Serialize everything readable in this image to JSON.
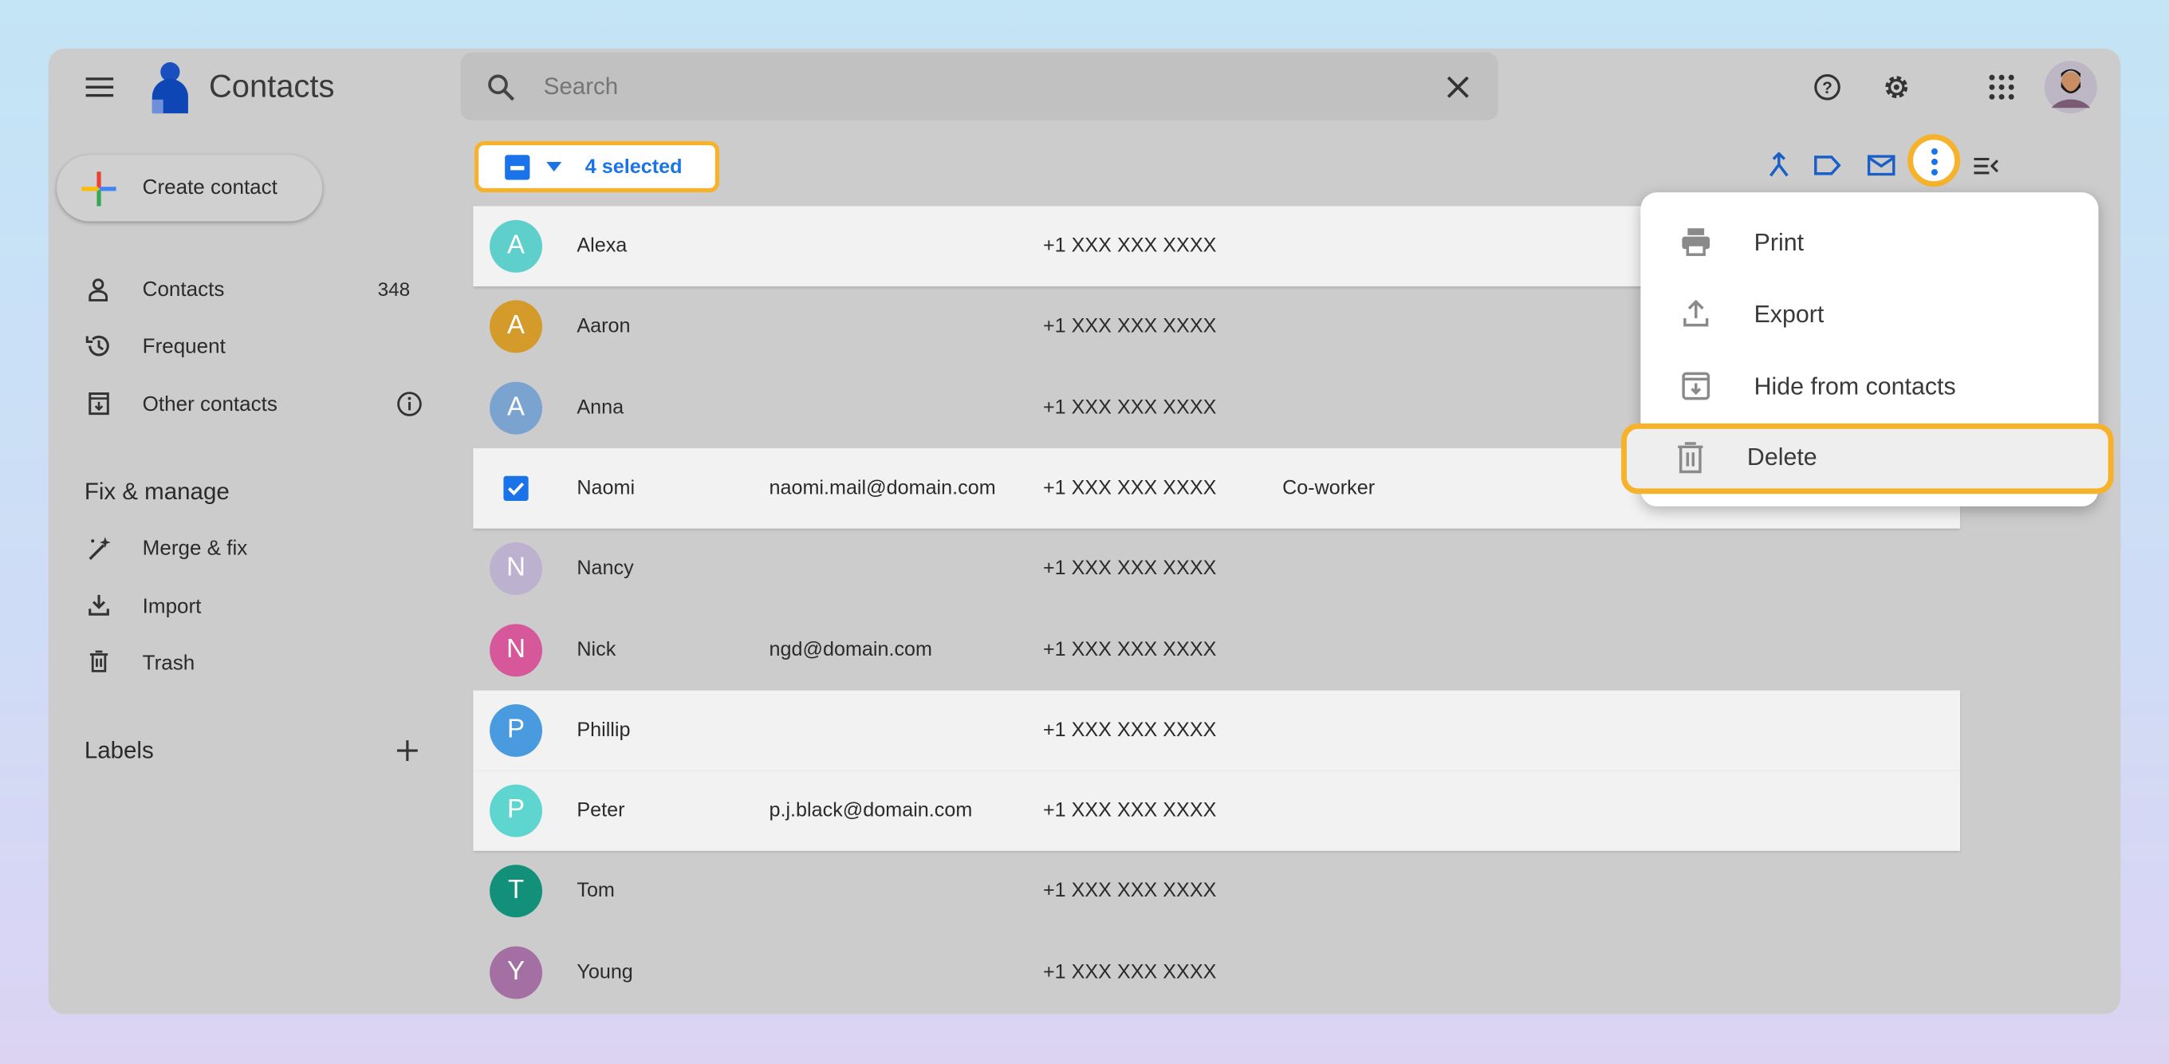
{
  "app": {
    "title": "Contacts"
  },
  "search": {
    "placeholder": "Search"
  },
  "selection": {
    "label": "4 selected"
  },
  "sidebar": {
    "create_label": "Create contact",
    "items": [
      {
        "label": "Contacts",
        "count": "348"
      },
      {
        "label": "Frequent"
      },
      {
        "label": "Other contacts"
      }
    ],
    "fix_heading": "Fix & manage",
    "fix_items": [
      {
        "label": "Merge & fix"
      },
      {
        "label": "Import"
      },
      {
        "label": "Trash"
      }
    ],
    "labels_heading": "Labels"
  },
  "contacts": [
    {
      "initial": "A",
      "name": "Alexa",
      "email": "",
      "phone": "+1 XXX XXX XXXX",
      "label": "",
      "color": "#5ecfca",
      "selected": true
    },
    {
      "initial": "A",
      "name": "Aaron",
      "email": "",
      "phone": "+1 XXX XXX XXXX",
      "label": "",
      "color": "#d49b2a",
      "selected": false
    },
    {
      "initial": "A",
      "name": "Anna",
      "email": "",
      "phone": "+1 XXX XXX XXXX",
      "label": "",
      "color": "#7ba3d0",
      "selected": false
    },
    {
      "initial": "",
      "name": "Naomi",
      "email": "naomi.mail@domain.com",
      "phone": "+1 XXX XXX XXXX",
      "label": "Co-worker",
      "color": "#1a73e8",
      "selected": true,
      "checked": true
    },
    {
      "initial": "N",
      "name": "Nancy",
      "email": "",
      "phone": "+1 XXX XXX XXXX",
      "label": "",
      "color": "#bcb1cf",
      "selected": false
    },
    {
      "initial": "N",
      "name": "Nick",
      "email": "ngd@domain.com",
      "phone": "+1 XXX XXX XXXX",
      "label": "",
      "color": "#d6579a",
      "selected": false
    },
    {
      "initial": "P",
      "name": "Phillip",
      "email": "",
      "phone": "+1 XXX XXX XXXX",
      "label": "",
      "color": "#4a9ae0",
      "selected": true
    },
    {
      "initial": "P",
      "name": "Peter",
      "email": "p.j.black@domain.com",
      "phone": "+1 XXX XXX XXXX",
      "label": "",
      "color": "#5fd5d0",
      "selected": true
    },
    {
      "initial": "T",
      "name": "Tom",
      "email": "",
      "phone": "+1 XXX XXX XXXX",
      "label": "",
      "color": "#12907a",
      "selected": false
    },
    {
      "initial": "Y",
      "name": "Young",
      "email": "",
      "phone": "+1 XXX XXX XXXX",
      "label": "",
      "color": "#a46fa3",
      "selected": false
    }
  ],
  "menu": {
    "items": [
      {
        "label": "Print",
        "icon": "print-icon"
      },
      {
        "label": "Export",
        "icon": "export-icon"
      },
      {
        "label": "Hide from contacts",
        "icon": "hide-icon"
      },
      {
        "label": "Delete",
        "icon": "trash-icon"
      }
    ]
  },
  "colors": {
    "accent": "#1a73e8",
    "highlight": "#f6b22a"
  }
}
